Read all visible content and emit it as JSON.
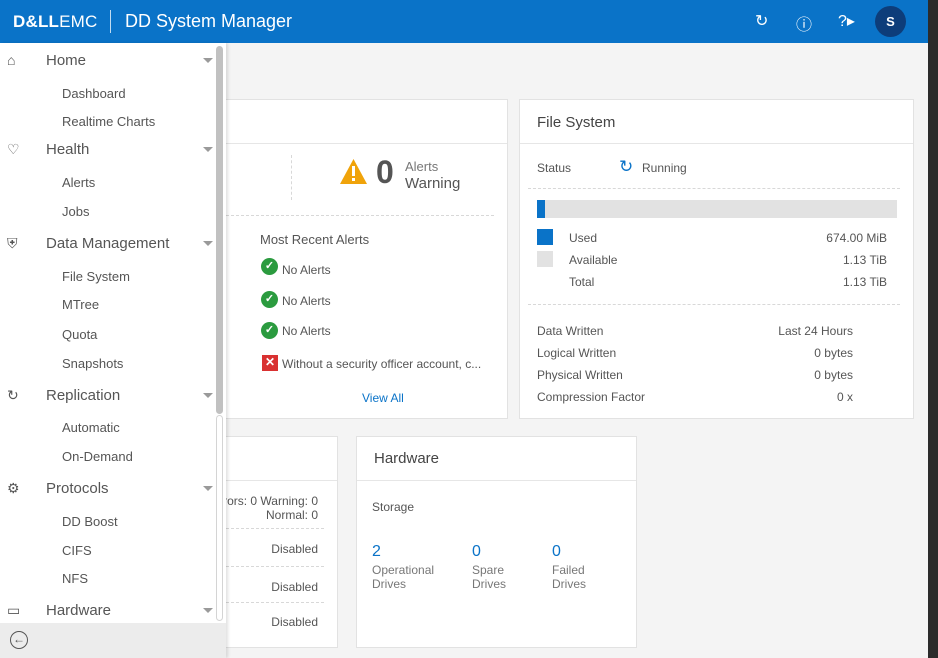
{
  "header": {
    "logo_bold": "D&LL",
    "logo_light": "EMC",
    "title": "DD System Manager",
    "avatar_initial": "S",
    "icons": [
      "refresh-icon",
      "info-icon",
      "help-icon",
      "avatar"
    ]
  },
  "colors": {
    "brand": "#0a73c8",
    "ok": "#2b9b3f",
    "error": "#d93131",
    "warning": "#f0a30a"
  },
  "alerts_card": {
    "warning_count": "0",
    "warning_label_top": "Alerts",
    "warning_label_bottom": "Warning",
    "recent_title": "Most Recent Alerts",
    "items": [
      "No Alerts",
      "No Alerts",
      "No Alerts"
    ],
    "error_item": "Without a security officer account, c...",
    "view_all": "View All"
  },
  "file_system": {
    "title": "File System",
    "status_label": "Status",
    "status_value": "Running",
    "usage_fraction": 0.02,
    "used_label": "Used",
    "used_value": "674.00 MiB",
    "available_label": "Available",
    "available_value": "1.13 TiB",
    "total_label": "Total",
    "total_value": "1.13 TiB",
    "data_written_label": "Data Written",
    "period_label": "Last 24 Hours",
    "logical_written_label": "Logical Written",
    "logical_written_value": "0 bytes",
    "physical_written_label": "Physical Written",
    "physical_written_value": "0 bytes",
    "compression_label": "Compression Factor",
    "compression_value": "0 x"
  },
  "services_card": {
    "summary_line1": "rors: 0 Warning: 0",
    "summary_line2": "Normal: 0",
    "status1": "Disabled",
    "status2": "Disabled",
    "status3": "Disabled"
  },
  "hardware": {
    "title": "Hardware",
    "storage_label": "Storage",
    "operational_count": "2",
    "operational_label1": "Operational",
    "operational_label2": "Drives",
    "spare_count": "0",
    "spare_label1": "Spare",
    "spare_label2": "Drives",
    "failed_count": "0",
    "failed_label1": "Failed",
    "failed_label2": "Drives"
  },
  "sidebar": {
    "groups": [
      {
        "label": "Home",
        "icon": "home-icon",
        "items": [
          "Dashboard",
          "Realtime Charts"
        ]
      },
      {
        "label": "Health",
        "icon": "heart-icon",
        "items": [
          "Alerts",
          "Jobs"
        ]
      },
      {
        "label": "Data Management",
        "icon": "shield-icon",
        "items": [
          "File System",
          "MTree",
          "Quota",
          "Snapshots"
        ]
      },
      {
        "label": "Replication",
        "icon": "sync-icon",
        "items": [
          "Automatic",
          "On-Demand"
        ]
      },
      {
        "label": "Protocols",
        "icon": "protocols-icon",
        "items": [
          "DD Boost",
          "CIFS",
          "NFS"
        ]
      },
      {
        "label": "Hardware",
        "icon": "drive-icon",
        "items": []
      }
    ]
  }
}
